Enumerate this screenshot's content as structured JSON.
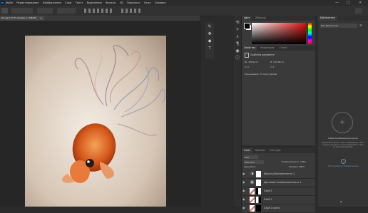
{
  "app": {
    "logo": "Ps"
  },
  "menu": {
    "items": [
      "Файл",
      "Редактирование",
      "Изображение",
      "Слои",
      "Текст",
      "Выделение",
      "Фильтр",
      "3D",
      "Просмотр",
      "Окно",
      "Справка"
    ]
  },
  "window_controls": {
    "minimize": "—",
    "maximize": "□",
    "close": "✕"
  },
  "document_tab": {
    "title": "ыба.jpg @ 32,5% (Кривые 1, RGB/8#)",
    "close": "×"
  },
  "color_panel": {
    "tabs": [
      "Цвет",
      "Образцы"
    ]
  },
  "properties_panel": {
    "tabs": [
      "Свойства",
      "Коррекция",
      "Стили"
    ],
    "section": "Свойства документа",
    "w": "Ш: 108,9 см",
    "h": "В: 100,96 см",
    "x": "X: 0",
    "y": "Y: 0",
    "resolution": "Разрешение: 72 пиксч/дюйм"
  },
  "libraries_panel": {
    "title": "Библиотеки",
    "library_select": "Мои библиотеки",
    "heading": "Перетаскивание ресурсов",
    "description": "Добавляйте цвета, стили, изображения, текст и другие ресурсы, а также работайте с ними во всех приложениях",
    "link": "Начать работу с библиотеками"
  },
  "layers_panel": {
    "tabs": [
      "Слои",
      "Каналы",
      "Контуры"
    ],
    "kind_filter": "Вид",
    "blend_mode": "Обычные",
    "opacity": "Непрозрачность: 100%",
    "lock_label": "Закрепить:",
    "fill": "Заливка: 100%",
    "layers": [
      {
        "name": "Яркость/Контрастность 1"
      },
      {
        "name": "Цветовой тон/Насыщенность 1"
      },
      {
        "name": "Слой 2"
      },
      {
        "name": "Слой 1"
      },
      {
        "name": "Слой 1 копия"
      }
    ]
  }
}
